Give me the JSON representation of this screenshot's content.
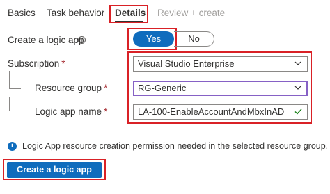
{
  "tabs": [
    {
      "label": "Basics",
      "state": "enabled"
    },
    {
      "label": "Task behavior",
      "state": "enabled"
    },
    {
      "label": "Details",
      "state": "selected"
    },
    {
      "label": "Review + create",
      "state": "disabled"
    }
  ],
  "form": {
    "create_logic_app_label": "Create a logic app",
    "toggle": {
      "yes": "Yes",
      "no": "No",
      "selected": "Yes"
    },
    "subscription": {
      "label": "Subscription",
      "required_marker": "*",
      "value": "Visual Studio Enterprise"
    },
    "resource_group": {
      "label": "Resource group",
      "required_marker": "*",
      "value": "RG-Generic"
    },
    "logic_app_name": {
      "label": "Logic app name",
      "required_marker": "*",
      "value": "LA-100-EnableAccountAndMbxInAD"
    }
  },
  "info_message": "Logic App resource creation permission needed in the selected resource group.",
  "create_button_label": "Create a logic app",
  "colors": {
    "accent": "#0f6cbd",
    "highlight_box": "#d92126",
    "required": "#a4262c",
    "valid_check": "#107c10",
    "focus_border": "#8661c5"
  },
  "icons": {
    "info_tooltip": "info-circle-icon",
    "info_bar": "info-filled-icon",
    "dropdown": "chevron-down-icon",
    "valid": "checkmark-icon"
  }
}
